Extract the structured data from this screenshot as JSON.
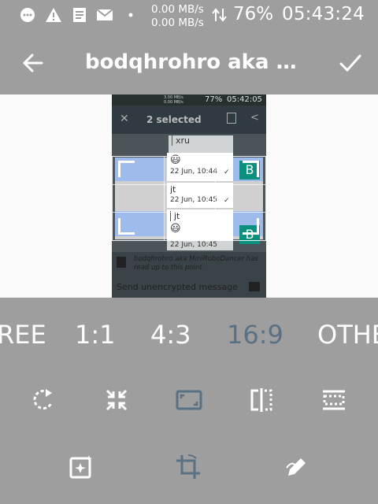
{
  "status_bar": {
    "net_speed_up": "0.00 MB/s",
    "net_speed_down": "0.00 MB/s",
    "battery": "76%",
    "time": "05:43:24",
    "icons": [
      "message-icon",
      "warning-icon",
      "news-icon",
      "mail-icon",
      "dot-icon",
      "data-arrows-icon"
    ]
  },
  "toolbar": {
    "back_icon": "arrow-left-icon",
    "title": "bodqhrohro aka Mi...",
    "done_icon": "check-icon"
  },
  "preview": {
    "status_bar": {
      "battery": "77%",
      "time": "05:42:05",
      "net": "3.00 MB/s",
      "net2": "0.00 MB/s"
    },
    "action_bar": {
      "title": "2 selected"
    },
    "messages": [
      {
        "text": "xru",
        "time": ""
      },
      {
        "text": "😃",
        "time": "22 Jun, 10:44"
      },
      {
        "text": "jt",
        "time": "22 Jun, 10:45"
      },
      {
        "text": "jt",
        "time": ""
      },
      {
        "text": "😃",
        "time": "22 Jun, 10:45"
      }
    ],
    "read_notice": "bodqhrohro aka MiniRoboDancer has read up to this point",
    "input_placeholder": "Send unencrypted message"
  },
  "aspect_ratios": {
    "items": [
      "REE",
      "1:1",
      "4:3",
      "16:9",
      "OTHE"
    ],
    "selected": "16:9"
  },
  "tools_row1": [
    "rotate-icon",
    "shrink-icon",
    "aspect-icon",
    "flip-icon",
    "straighten-icon"
  ],
  "tools_row2": [
    "auto-enhance-icon",
    "crop-icon",
    "draw-icon"
  ],
  "colors": {
    "background": "#9e9e9e",
    "selected_accent": "#5a7184",
    "crop_highlight": "#9fbbeb",
    "teal": "#0b8f7e"
  }
}
